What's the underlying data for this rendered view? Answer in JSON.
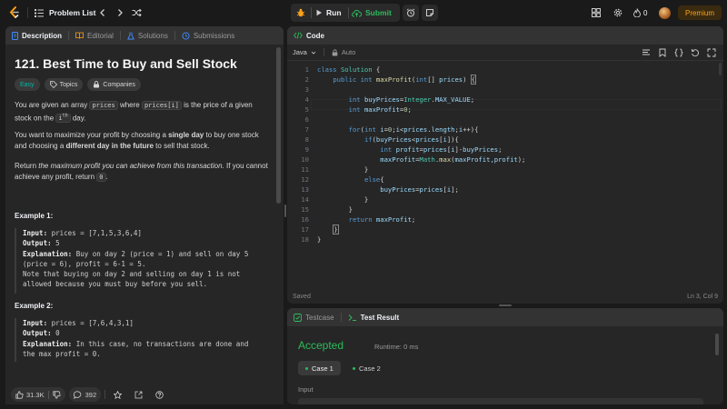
{
  "topbar": {
    "problem_list_label": "Problem List",
    "run_label": "Run",
    "submit_label": "Submit",
    "coins": "0",
    "premium_label": "Premium",
    "accent": "#ffa116",
    "submit_color": "#2cbb5d"
  },
  "left": {
    "tabs": [
      "Description",
      "Editorial",
      "Solutions",
      "Submissions"
    ],
    "title": "121. Best Time to Buy and Sell Stock",
    "chips": [
      "Easy",
      "Topics",
      "Companies"
    ],
    "p1_a": "You are given an array ",
    "p1_code1": "prices",
    "p1_b": " where ",
    "p1_code2": "prices[i]",
    "p1_c": " is the price of a given stock on the ",
    "p1_sup": "ith",
    "p1_d": " day.",
    "p2_a": "You want to maximize your profit by choosing a ",
    "p2_b1": "single day",
    "p2_b": " to buy one stock and choosing a ",
    "p2_b2": "different day in the future",
    "p2_c": " to sell that stock.",
    "p3_a": "Return ",
    "p3_i": "the maximum profit you can achieve from this transaction",
    "p3_b": ". If you cannot achieve any profit, return ",
    "p3_code": "0",
    "p3_c": ".",
    "example1_title": "Example 1:",
    "example1": {
      "input_label": "Input:",
      "input": " prices = [7,1,5,3,6,4]",
      "output_label": "Output:",
      "output": " 5",
      "expl_label": "Explanation:",
      "expl1": " Buy on day 2 (price = 1) and sell on day 5",
      "expl2": "(price = 6), profit = 6-1 = 5.",
      "expl3": "Note that buying on day 2 and selling on day 1 is not",
      "expl4": "allowed because you must buy before you sell."
    },
    "example2_title": "Example 2:",
    "example2": {
      "input_label": "Input:",
      "input": " prices = [7,6,4,3,1]",
      "output_label": "Output:",
      "output": " 0",
      "expl_label": "Explanation:",
      "expl1": " In this case, no transactions are done and",
      "expl2": "the max profit = 0."
    },
    "likes": "31.3K",
    "comments": "392"
  },
  "code": {
    "tab_label": "Code",
    "language": "Java",
    "auto_label": "Auto",
    "status_left": "Saved",
    "status_right": "Ln 3, Col 9",
    "line_numbers": [
      "1",
      "2",
      "3",
      "4",
      "5",
      "6",
      "7",
      "8",
      "9",
      "10",
      "11",
      "12",
      "13",
      "14",
      "15",
      "16",
      "17",
      "18"
    ]
  },
  "result": {
    "tabs": [
      "Testcase",
      "Test Result"
    ],
    "status": "Accepted",
    "runtime": "Runtime: 0 ms",
    "cases": [
      "Case 1",
      "Case 2"
    ],
    "input_label": "Input"
  }
}
